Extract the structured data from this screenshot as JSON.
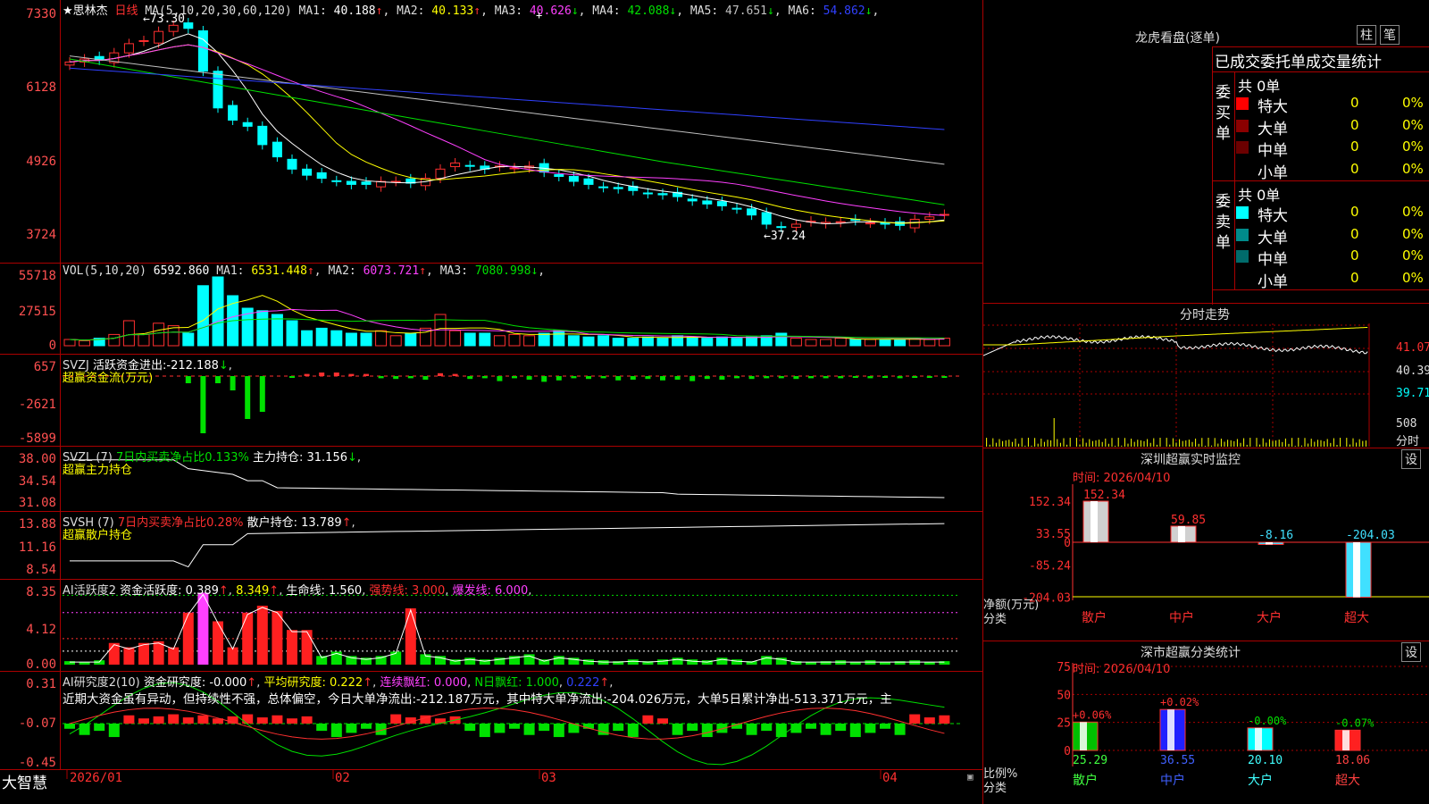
{
  "app": {
    "brand": "大智慧"
  },
  "kline": {
    "ticker_label": "★思林杰",
    "period": "日线",
    "ma_params": "MA(5,10,20,30,60,120)",
    "ma": [
      {
        "label": "MA1:",
        "value": "40.188",
        "arrow": "↑",
        "color": "#ffffff"
      },
      {
        "label": "MA2:",
        "value": "40.133",
        "arrow": "↑",
        "color": "#ffff00"
      },
      {
        "label": "MA3:",
        "value": "40.626",
        "arrow": "↓",
        "color": "#ff40ff"
      },
      {
        "label": "MA4:",
        "value": "42.088",
        "arrow": "↓",
        "color": "#00e000"
      },
      {
        "label": "MA5:",
        "value": "47.651",
        "arrow": "↓",
        "color": "#c0c0c0"
      },
      {
        "label": "MA6:",
        "value": "54.862",
        "arrow": "↓",
        "color": "#3040ff"
      }
    ],
    "yticks": [
      "7330",
      "6128",
      "4926",
      "3724"
    ],
    "high_label": "73.30",
    "low_label": "37.24"
  },
  "vol": {
    "params": "VOL(5,10,20)",
    "value": "6592.860",
    "ma": [
      {
        "label": "MA1:",
        "value": "6531.448",
        "arrow": "↑",
        "color": "#ffff00"
      },
      {
        "label": "MA2:",
        "value": "6073.721",
        "arrow": "↑",
        "color": "#ff40ff"
      },
      {
        "label": "MA3:",
        "value": "7080.998",
        "arrow": "↓",
        "color": "#00e000"
      }
    ],
    "yticks": [
      "55718",
      "27515",
      "0"
    ]
  },
  "svzj": {
    "name": "SVZJ",
    "label": "活跃资金进出:",
    "value": "-212.188",
    "arrow": "↓",
    "sub": "超赢资金流(万元)",
    "yticks": [
      "657",
      "-2621",
      "-5899"
    ]
  },
  "svzl": {
    "name": "SVZL (7)",
    "label1": "7日内买卖净占比0.133%",
    "label2": "主力持仓:",
    "value": "31.156",
    "arrow": "↓",
    "sub": "超赢主力持仓",
    "yticks": [
      "38.00",
      "34.54",
      "31.08"
    ]
  },
  "svsh": {
    "name": "SVSH (7)",
    "label1": "7日内买卖净占比0.28%",
    "label2": "散户持仓:",
    "value": "13.789",
    "arrow": "↑",
    "sub": "超赢散户持仓",
    "yticks": [
      "13.88",
      "11.16",
      "8.54"
    ]
  },
  "ai1": {
    "name": "AI活跃度2",
    "l1": "资金活跃度:",
    "v1": "0.389",
    "v1a": "↑",
    "v2": "8.349",
    "l3": "生命线:",
    "v3": "1.560",
    "l4": "强势线:",
    "v4": "3.000",
    "l5": "爆发线:",
    "v5": "6.000",
    "yticks": [
      "8.35",
      "4.12",
      "0.00"
    ]
  },
  "ai2": {
    "name": "AI研究度2(10)",
    "l1": "资金研究度:",
    "v1": "-0.000",
    "v1a": "↑",
    "l2": "平均研究度:",
    "v2": "0.222",
    "v2a": "↑",
    "l3": "连续飘红:",
    "v3": "0.000",
    "l4": "N日飘红:",
    "v4": "1.000",
    "v5": "0.222",
    "v5a": "↑",
    "comment": "近期大资金虽有异动，但持续性不强，总体偏空，今日大单净流出:-212.187万元，其中特大单净流出:-204.026万元，大单5日累计净出-513.371万元，主",
    "yticks": [
      "0.31",
      "-0.07",
      "-0.45"
    ]
  },
  "xaxis": [
    "2026/01",
    "02",
    "03",
    "04"
  ],
  "lhb": {
    "title": "龙虎看盘(逐单)",
    "btn1": "柱",
    "btn2": "笔",
    "heading": "已成交委托单成交量统计",
    "buy": {
      "side": "委买单",
      "total": "共 0单",
      "rows": [
        {
          "name": "特大",
          "count": "0",
          "pct": "0%",
          "color": "#ff0000"
        },
        {
          "name": "大单",
          "count": "0",
          "pct": "0%",
          "color": "#8b0000"
        },
        {
          "name": "中单",
          "count": "0",
          "pct": "0%",
          "color": "#6b0000"
        },
        {
          "name": "小单",
          "count": "0",
          "pct": "0%",
          "color": ""
        }
      ]
    },
    "sell": {
      "side": "委卖单",
      "total": "共 0单",
      "rows": [
        {
          "name": "特大",
          "count": "0",
          "pct": "0%",
          "color": "#00ffff"
        },
        {
          "name": "大单",
          "count": "0",
          "pct": "0%",
          "color": "#008b8b"
        },
        {
          "name": "中单",
          "count": "0",
          "pct": "0%",
          "color": "#006b6b"
        },
        {
          "name": "小单",
          "count": "0",
          "pct": "0%",
          "color": ""
        }
      ]
    }
  },
  "fenshi": {
    "title": "分时走势",
    "yticks": [
      "41.07",
      "40.39",
      "39.71"
    ],
    "vol_tick": "508",
    "vol_label": "分时"
  },
  "monitor": {
    "title": "深圳超赢实时监控",
    "btn": "设",
    "time": "时间: 2026/04/10",
    "yticks": [
      "152.34",
      "33.55",
      "0",
      "-85.24",
      "-204.03"
    ],
    "ylabel": "净额(万元)",
    "xlabel": "分类",
    "bars": [
      {
        "cat": "散户",
        "value": 152.34,
        "label": "152.34",
        "color": "#ff3030"
      },
      {
        "cat": "中户",
        "value": 59.85,
        "label": "59.85",
        "color": "#ff3030"
      },
      {
        "cat": "大户",
        "value": -8.16,
        "label": "-8.16",
        "color": "#40e0ff"
      },
      {
        "cat": "超大",
        "value": -204.03,
        "label": "-204.03",
        "color": "#40e0ff"
      }
    ]
  },
  "classify": {
    "title": "深市超赢分类统计",
    "btn": "设",
    "time": "时间: 2026/04/10",
    "yticks": [
      "75",
      "50",
      "25",
      "0"
    ],
    "ylabel": "比例%",
    "xlabel": "分类",
    "bars": [
      {
        "cat": "散户",
        "value": 25.29,
        "label": "25.29",
        "change": "+0.06%",
        "color": "#00c000",
        "change_color": "#ff3030"
      },
      {
        "cat": "中户",
        "value": 36.55,
        "label": "36.55",
        "change": "+0.02%",
        "color": "#2020ff",
        "change_color": "#ff3030"
      },
      {
        "cat": "大户",
        "value": 20.1,
        "label": "20.10",
        "change": "-0.00%",
        "color": "#00ffff",
        "change_color": "#00e000"
      },
      {
        "cat": "超大",
        "value": 18.06,
        "label": "18.06",
        "change": "-0.07%",
        "color": "#ff2020",
        "change_color": "#00e000"
      }
    ]
  },
  "chart_data": {
    "type": "bar",
    "title": "深圳超赢实时监控",
    "categories": [
      "散户",
      "中户",
      "大户",
      "超大"
    ],
    "values": [
      152.34,
      59.85,
      -8.16,
      -204.03
    ],
    "ylabel": "净额(万元)",
    "xlabel": "分类"
  }
}
